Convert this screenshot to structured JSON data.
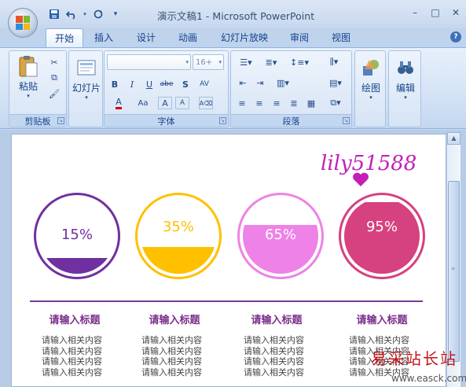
{
  "window": {
    "title": "演示文稿1 - Microsoft PowerPoint",
    "controls": {
      "minimize": "–",
      "maximize": "□",
      "close": "✕"
    }
  },
  "qat": {
    "save": "save-icon",
    "undo": "undo-icon",
    "redo": "redo-icon",
    "more": "▾"
  },
  "tabs": [
    {
      "label": "开始",
      "active": true
    },
    {
      "label": "插入"
    },
    {
      "label": "设计"
    },
    {
      "label": "动画"
    },
    {
      "label": "幻灯片放映"
    },
    {
      "label": "审阅"
    },
    {
      "label": "视图"
    }
  ],
  "help": "?",
  "ribbon": {
    "clipboard": {
      "paste": "粘贴",
      "group": "剪贴板"
    },
    "slides": {
      "slide": "幻灯片"
    },
    "font": {
      "group": "字体",
      "font_name": "",
      "font_size": "16+"
    },
    "paragraph": {
      "group": "段落"
    },
    "drawing": {
      "label": "绘图"
    },
    "editing": {
      "label": "编辑"
    }
  },
  "slide": {
    "signature": "lily51588",
    "circles": [
      {
        "value": "15%",
        "fill": 0.15,
        "color": "#7030a0",
        "text_color": "#7030a0"
      },
      {
        "value": "35%",
        "fill": 0.35,
        "color": "#ffc000",
        "text_color": "#ffc000"
      },
      {
        "value": "65%",
        "fill": 0.65,
        "color": "#ee82e6",
        "text_color": "#ffffff"
      },
      {
        "value": "95%",
        "fill": 0.95,
        "color": "#d6417f",
        "text_color": "#ffffff"
      }
    ],
    "columns": [
      {
        "title": "请输入标题",
        "lines": [
          "请输入相关内容",
          "请输入相关内容",
          "请输入相关内容",
          "请输入相关内容"
        ]
      },
      {
        "title": "请输入标题",
        "lines": [
          "请输入相关内容",
          "请输入相关内容",
          "请输入相关内容",
          "请输入相关内容"
        ]
      },
      {
        "title": "请输入标题",
        "lines": [
          "请输入相关内容",
          "请输入相关内容",
          "请输入相关内容",
          "请输入相关内容"
        ]
      },
      {
        "title": "请输入标题",
        "lines": [
          "请输入相关内容",
          "请输入相关内容",
          "请输入相关内容",
          "请输入相关内容"
        ]
      }
    ]
  },
  "watermark": {
    "text": "易采站长站",
    "url": "www.easck.com"
  }
}
